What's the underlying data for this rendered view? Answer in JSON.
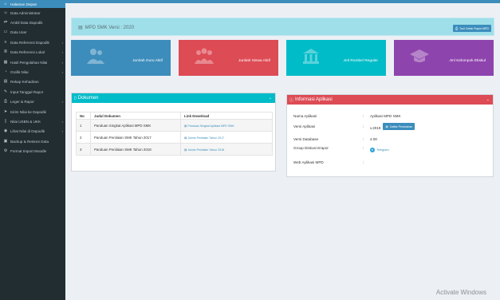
{
  "sidebar": {
    "items": [
      {
        "label": "Halaman Depan",
        "icon": "home-icon",
        "glyph": "⌂",
        "chevron": ""
      },
      {
        "label": "Data Administrator",
        "icon": "user-icon",
        "glyph": "☺",
        "chevron": ""
      },
      {
        "label": "Ambil Data Dapodik",
        "icon": "exchange-icon",
        "glyph": "⇄",
        "chevron": ""
      },
      {
        "label": "Data User",
        "icon": "folder-icon",
        "glyph": "▭",
        "chevron": ""
      },
      {
        "label": "Data Referensi Dapodik",
        "icon": "database-icon",
        "glyph": "≡",
        "chevron": "‹"
      },
      {
        "label": "Data Referensi Lokal",
        "icon": "list-icon",
        "glyph": "≣",
        "chevron": "‹"
      },
      {
        "label": "Hasil Pengolahan Nilai",
        "icon": "table-icon",
        "glyph": "▦",
        "chevron": "‹"
      },
      {
        "label": "Grafik Nilai",
        "icon": "chart-icon",
        "glyph": "◔",
        "chevron": "‹"
      },
      {
        "label": "Rekap Kehadiran",
        "icon": "calendar-icon",
        "glyph": "▤",
        "chevron": ""
      },
      {
        "label": "Input Tanggal Rapor",
        "icon": "edit-icon",
        "glyph": "✎",
        "chevron": ""
      },
      {
        "label": "Leger & Rapor",
        "icon": "print-icon",
        "glyph": "⎙",
        "chevron": "‹"
      },
      {
        "label": "Kirim Nilai ke Dapodik",
        "icon": "send-icon",
        "glyph": "➤",
        "chevron": ""
      },
      {
        "label": "Nilai USBN & UKK",
        "icon": "file-icon",
        "glyph": "▯",
        "chevron": "‹"
      },
      {
        "label": "Lihat Nilai di Dapodik",
        "icon": "eye-icon",
        "glyph": "◉",
        "chevron": "‹"
      },
      {
        "label": "Backup & Restore Data",
        "icon": "save-icon",
        "glyph": "▣",
        "chevron": ""
      },
      {
        "label": "Format Import Moodle",
        "icon": "gear-icon",
        "glyph": "⚙",
        "chevron": ""
      }
    ]
  },
  "header": {
    "version_title": "MPD SMK Versi : 2020",
    "rapor_button": "Tool Cetak Rapor MPD"
  },
  "stats": [
    {
      "label": "Jumlah Guru Aktif",
      "icon": "users-icon",
      "glyph": "👥"
    },
    {
      "label": "Jumlah Siswa Aktif",
      "icon": "students-icon",
      "glyph": "👪"
    },
    {
      "label": "Jml Rombel Reguler",
      "icon": "building-icon",
      "glyph": "⌂"
    },
    {
      "label": "Jml Kelompok Ekskul",
      "icon": "graduation-cap-icon",
      "glyph": "🎓"
    }
  ],
  "dokumen": {
    "title": "Dokumen",
    "columns": [
      "No",
      "Judul Dokumen",
      "Link Download"
    ],
    "rows": [
      {
        "no": "1",
        "judul": "Panduan Singkat Aplikasi MPD SMK",
        "link": "Panduan Singkat Aplikasi MPD SMK"
      },
      {
        "no": "2",
        "judul": "Panduan Penilaian SMK Tahun 2017",
        "link": "Juknis Penilaian Tahun 2017"
      },
      {
        "no": "3",
        "judul": "Panduan Penilaian SMK Tahun 2018",
        "link": "Juknis Penilaian Tahun 2018"
      }
    ]
  },
  "informasi": {
    "title": "Informasi Aplikasi",
    "rows": [
      {
        "label": "Nama Aplikasi",
        "colon": ":",
        "value": "Aplikasi MPD SMK"
      },
      {
        "label": "Versi Aplikasi",
        "colon": ":",
        "value": "v.2019",
        "button": "Daftar Perubahan"
      },
      {
        "label": "Versi Database",
        "colon": ":",
        "value": "4.00"
      },
      {
        "label": "Group Diskusi Erapor",
        "colon": ":",
        "value": "Telegram"
      },
      {
        "label": "Web Aplikasi MPD",
        "colon": ":",
        "value": ""
      }
    ]
  },
  "watermark": "Activate Windows"
}
